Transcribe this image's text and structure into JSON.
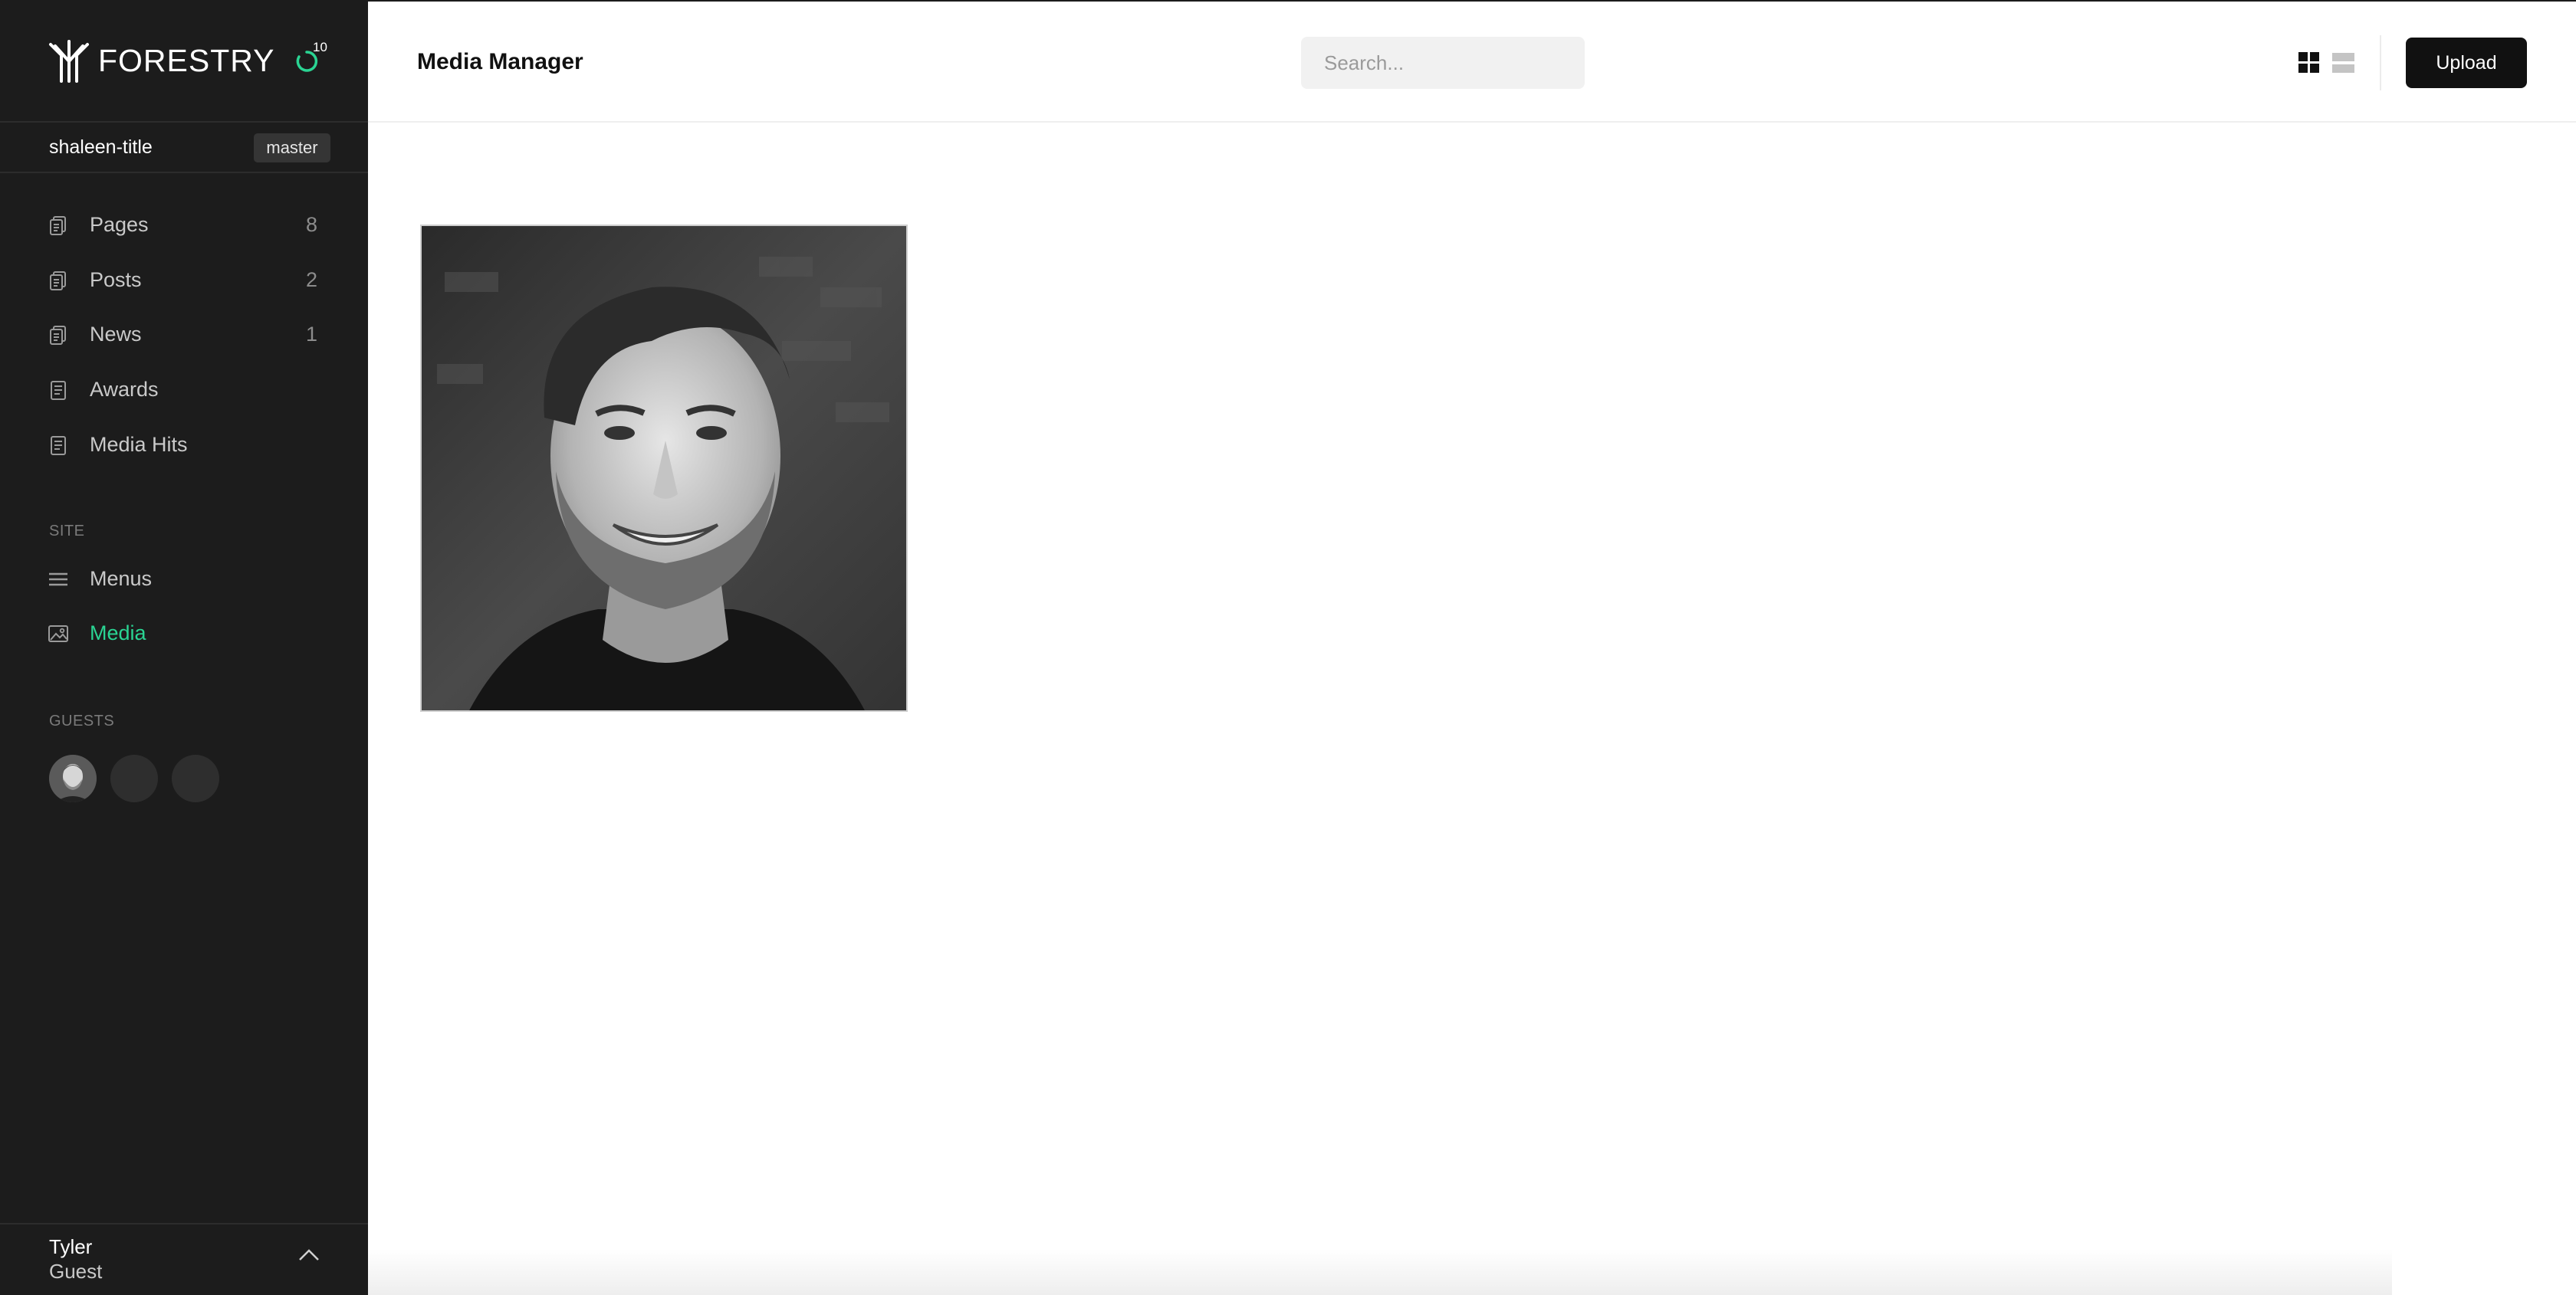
{
  "app": {
    "brand": "FORESTRY",
    "sync_count": "10",
    "accent_color": "#2ad493",
    "sidebar_bg": "#1c1c1c"
  },
  "site": {
    "name": "shaleen-title",
    "branch": "master"
  },
  "sidebar": {
    "content_items": [
      {
        "label": "Pages",
        "count": "8",
        "icon": "document-stack-icon"
      },
      {
        "label": "Posts",
        "count": "2",
        "icon": "document-stack-icon"
      },
      {
        "label": "News",
        "count": "1",
        "icon": "document-stack-icon"
      },
      {
        "label": "Awards",
        "count": "",
        "icon": "document-icon"
      },
      {
        "label": "Media Hits",
        "count": "",
        "icon": "document-icon"
      }
    ],
    "site_section": {
      "heading": "SITE",
      "items": [
        {
          "label": "Menus",
          "icon": "menu-lines-icon"
        },
        {
          "label": "Media",
          "icon": "image-icon",
          "active": true
        }
      ]
    },
    "guests_section": {
      "heading": "GUESTS"
    }
  },
  "user": {
    "name": "Tyler",
    "role": "Guest"
  },
  "header": {
    "title": "Media Manager",
    "search_placeholder": "Search...",
    "upload_label": "Upload",
    "view_mode": "grid"
  },
  "media": {
    "items": [
      {
        "type": "image",
        "subject": "black-and-white portrait of a smiling bearded man"
      }
    ]
  }
}
